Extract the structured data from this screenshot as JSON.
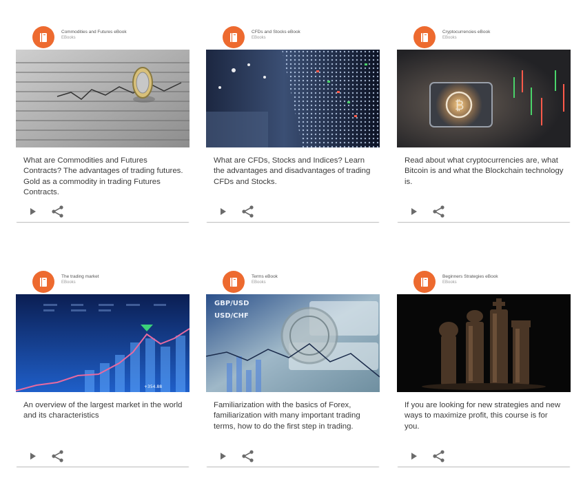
{
  "colors": {
    "accent": "#ed6a2f"
  },
  "cards": [
    {
      "title": "Commodities and Futures eBook",
      "subtitle": "EBooks",
      "description": "What are Commodities and Futures Contracts? The advantages of trading futures. Gold as a commodity in trading Futures Contracts.",
      "icon": "book-icon",
      "image": "coin-on-newspaper"
    },
    {
      "title": "CFDs and Stocks eBook",
      "subtitle": "EBooks",
      "description": "What are CFDs, Stocks and Indices? Learn the advantages and disadvantages of trading CFDs and Stocks.",
      "icon": "book-icon",
      "image": "stock-ticker-board"
    },
    {
      "title": "Cryptocurrencies eBook",
      "subtitle": "EBooks",
      "description": "Read about what cryptocurrencies are, what Bitcoin is and what the Blockchain technology is.",
      "icon": "book-icon",
      "image": "bitcoin-tablet"
    },
    {
      "title": "The trading market",
      "subtitle": "EBooks",
      "description": "An overview of the largest market in the world and its characteristics",
      "icon": "book-icon",
      "image": "blue-market-chart",
      "image_text": [
        "+354.88"
      ]
    },
    {
      "title": "Terms eBook",
      "subtitle": "EBooks",
      "description": "Familiarization with the basics of Forex, familiarization with many important trading terms, how to do the first step in trading.",
      "icon": "book-icon",
      "image": "forex-banknotes",
      "image_text": [
        "GBP/USD",
        "USD/CHF"
      ]
    },
    {
      "title": "Beginners Strategies eBook",
      "subtitle": "EBooks",
      "description": "If you are looking for new strategies and new ways to maximize profit, this course is for you.",
      "icon": "book-icon",
      "image": "chess-pieces"
    }
  ],
  "actions": {
    "play": "play-icon",
    "share": "share-icon"
  }
}
